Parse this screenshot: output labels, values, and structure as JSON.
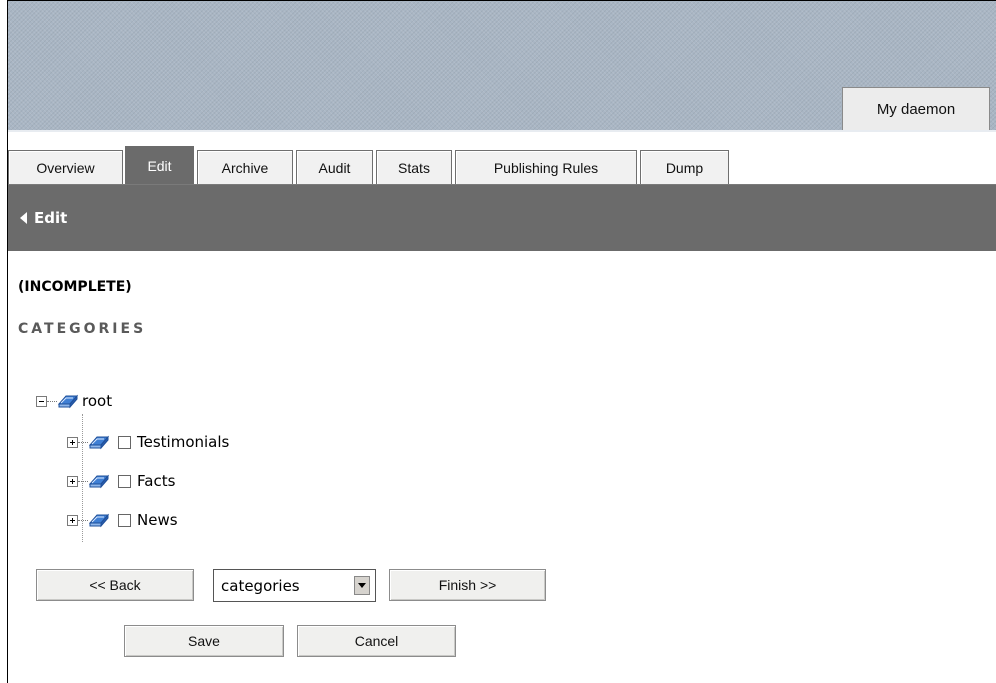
{
  "header": {
    "account_tab_label": "My daemon"
  },
  "tabs": [
    {
      "label": "Overview",
      "active": false
    },
    {
      "label": "Edit",
      "active": true
    },
    {
      "label": "Archive",
      "active": false
    },
    {
      "label": "Audit",
      "active": false
    },
    {
      "label": "Stats",
      "active": false
    },
    {
      "label": "Publishing Rules",
      "active": false
    },
    {
      "label": "Dump",
      "active": false
    }
  ],
  "edit_bar": {
    "title": "Edit",
    "icon": "triangle-left-icon"
  },
  "content": {
    "status": "(INCOMPLETE)",
    "section_heading": "CATEGORIES"
  },
  "tree": {
    "root": {
      "label": "root",
      "expanded": true,
      "icon": "folder-icon"
    },
    "children": [
      {
        "label": "Testimonials",
        "expanded": false,
        "checked": false,
        "icon": "folder-icon"
      },
      {
        "label": "Facts",
        "expanded": false,
        "checked": false,
        "icon": "folder-icon"
      },
      {
        "label": "News",
        "expanded": false,
        "checked": false,
        "icon": "folder-icon"
      }
    ]
  },
  "wizard": {
    "back_label": "<< Back",
    "step_selected": "categories",
    "finish_label": "Finish >>",
    "save_label": "Save",
    "cancel_label": "Cancel"
  },
  "colors": {
    "header_band": "#a9b6c4",
    "active_tab": "#6b6b6b",
    "edit_bar": "#6b6b6b",
    "tab_bg": "#f1f1f1",
    "heading_gray": "#5a5a5a",
    "folder_blue": "#3f7fd4"
  }
}
